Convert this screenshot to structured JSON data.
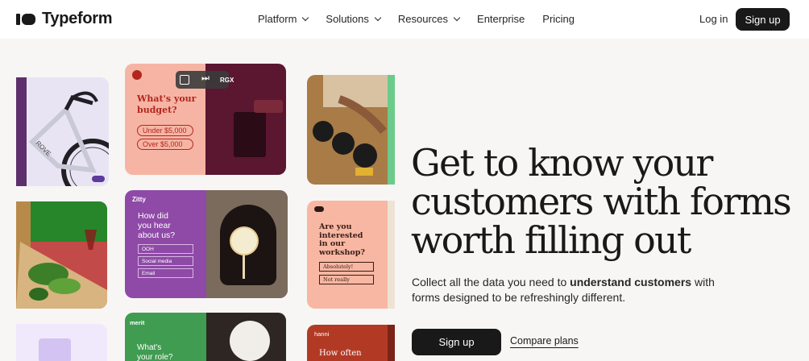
{
  "brand": {
    "name": "Typeform"
  },
  "nav": {
    "items": [
      {
        "label": "Platform",
        "dropdown": true
      },
      {
        "label": "Solutions",
        "dropdown": true
      },
      {
        "label": "Resources",
        "dropdown": true
      },
      {
        "label": "Enterprise",
        "dropdown": false
      },
      {
        "label": "Pricing",
        "dropdown": false
      }
    ],
    "login": "Log in",
    "signup": "Sign up"
  },
  "hero": {
    "headline_lines": [
      "Get to know your",
      "customers with forms",
      "worth filling out"
    ],
    "subtext_line1_pre": "Collect all the data you need to ",
    "subtext_line1_strong": "understand customers",
    "subtext_line1_post": " with",
    "subtext_line2": "forms designed to be refreshingly different.",
    "primary_cta": "Sign up",
    "secondary_cta": "Compare plans"
  },
  "collage": {
    "budget_card": {
      "badge": "RGX",
      "question": [
        "What's your",
        "budget?"
      ],
      "options": [
        "Under $5,000",
        "Over $5,000"
      ]
    },
    "zitty_card": {
      "brand": "Zitty",
      "question": [
        "How did",
        "you hear",
        "about us?"
      ],
      "options": [
        "OOH",
        "Social media",
        "Email"
      ]
    },
    "workshop_card": {
      "question": [
        "Are you",
        "interested",
        "in our",
        "workshop?"
      ],
      "options": [
        "Absolutely!",
        "Not really"
      ]
    },
    "merit_card": {
      "brand": "merit",
      "question": [
        "What's",
        "your role?"
      ]
    },
    "hanni_card": {
      "brand": "hanni",
      "question": [
        "How often"
      ]
    }
  },
  "colors": {
    "accent_dark": "#191919",
    "budget_pink": "#f6b5a4",
    "zitty_purple": "#8e4aa6",
    "workshop_pink": "#f7b7a3",
    "merit_green": "#3f9c51",
    "hanni_red": "#b23a25"
  }
}
